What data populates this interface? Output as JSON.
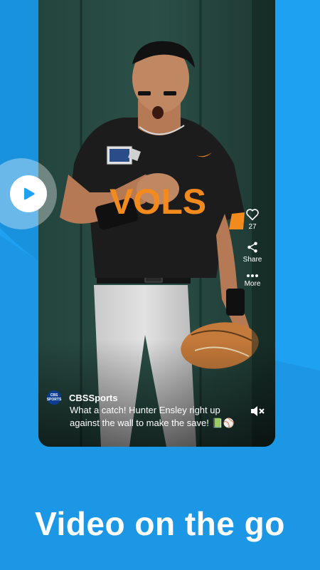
{
  "colors": {
    "background": "#1ea1f0",
    "accent_orange": "#f28a1e",
    "jersey": "#1c1c1c",
    "wall": "#1f3b35"
  },
  "video": {
    "jersey_text": "VOLS",
    "source": {
      "name": "CBSSports",
      "logo_text": "CBS SPORTS"
    },
    "caption": "What a catch! Hunter Ensley right up against the wall to make the save! 📗⚾",
    "actions": {
      "like": {
        "icon": "heart-icon",
        "label": "27"
      },
      "share": {
        "icon": "share-icon",
        "label": "Share"
      },
      "more": {
        "icon": "more-icon",
        "label": "More"
      }
    },
    "mute_icon": "muted-speaker-icon"
  },
  "play_icon": "play-icon",
  "tagline": "Video on the go"
}
